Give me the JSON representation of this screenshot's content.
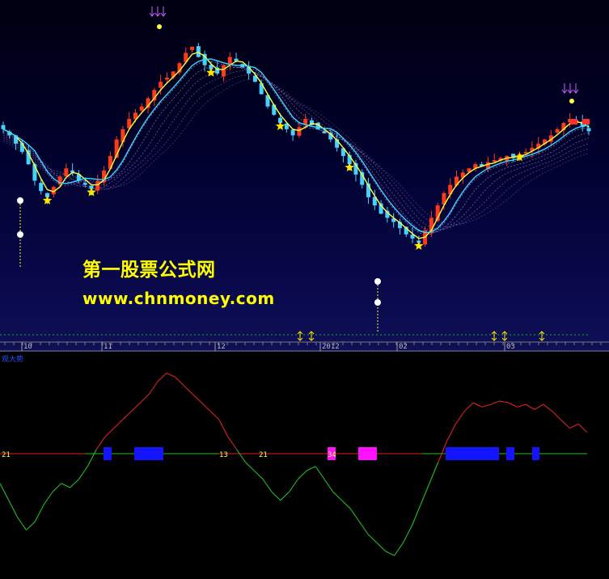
{
  "watermark": {
    "title": "第一股票公式网",
    "url": "www.chnmoney.com"
  },
  "indicator_title": "观大势",
  "axis_labels": [
    "10",
    "11",
    "12",
    "2012",
    "02",
    "03"
  ],
  "count_labels": [
    {
      "text": "21",
      "color": "#ffff40"
    },
    {
      "text": "13",
      "color": "#ffff40"
    },
    {
      "text": "21",
      "color": "#ffff40"
    },
    {
      "text": "34",
      "color": "#ffff40"
    }
  ],
  "colors": {
    "candle_up": "#ff3a1a",
    "candle_down": "#46d2ff",
    "ma_fast": "#ffff3a",
    "ma_slow": "#3ad7ff",
    "ribbon": "#c8a0ff",
    "signal_star": "#ffe600",
    "indicator_up": "#e02020",
    "indicator_down": "#20c020",
    "block_blue": "#1414ff",
    "block_magenta": "#ff10ff",
    "grid_dotted": "#00c000"
  },
  "icons": [
    "star-marker-icon",
    "down-arrow-signal-icon",
    "up-arrow-signal-icon",
    "dot-marker-icon"
  ],
  "chart_data": {
    "type": "candlestick",
    "close_relative": [
      0.55,
      0.52,
      0.48,
      0.44,
      0.38,
      0.3,
      0.25,
      0.22,
      0.27,
      0.32,
      0.36,
      0.34,
      0.3,
      0.28,
      0.26,
      0.3,
      0.35,
      0.42,
      0.5,
      0.55,
      0.6,
      0.63,
      0.66,
      0.7,
      0.74,
      0.78,
      0.8,
      0.83,
      0.87,
      0.92,
      0.95,
      0.9,
      0.86,
      0.84,
      0.82,
      0.86,
      0.9,
      0.88,
      0.85,
      0.82,
      0.78,
      0.72,
      0.66,
      0.62,
      0.58,
      0.55,
      0.52,
      0.56,
      0.6,
      0.57,
      0.55,
      0.53,
      0.5,
      0.46,
      0.42,
      0.38,
      0.33,
      0.28,
      0.22,
      0.18,
      0.14,
      0.12,
      0.1,
      0.07,
      0.04,
      0.02,
      0.0,
      0.06,
      0.12,
      0.18,
      0.24,
      0.28,
      0.32,
      0.34,
      0.36,
      0.38,
      0.37,
      0.39,
      0.4,
      0.41,
      0.42,
      0.41,
      0.43,
      0.44,
      0.46,
      0.48,
      0.5,
      0.52,
      0.55,
      0.58,
      0.6,
      0.58,
      0.56,
      0.54
    ],
    "indicator": [
      -0.35,
      -0.55,
      -0.75,
      -0.9,
      -0.8,
      -0.6,
      -0.45,
      -0.35,
      -0.4,
      -0.3,
      -0.15,
      0.05,
      0.2,
      0.3,
      0.4,
      0.5,
      0.6,
      0.7,
      0.85,
      0.95,
      0.9,
      0.8,
      0.7,
      0.6,
      0.5,
      0.4,
      0.2,
      0.05,
      -0.1,
      -0.2,
      -0.3,
      -0.45,
      -0.55,
      -0.45,
      -0.3,
      -0.2,
      -0.15,
      -0.3,
      -0.45,
      -0.55,
      -0.65,
      -0.8,
      -0.95,
      -1.05,
      -1.15,
      -1.2,
      -1.05,
      -0.85,
      -0.6,
      -0.35,
      -0.1,
      0.15,
      0.35,
      0.5,
      0.6,
      0.55,
      0.58,
      0.62,
      0.6,
      0.55,
      0.58,
      0.52,
      0.58,
      0.5,
      0.4,
      0.3,
      0.35,
      0.25
    ]
  }
}
